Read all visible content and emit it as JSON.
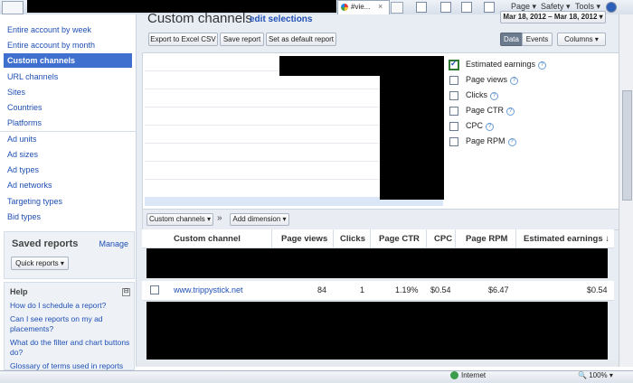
{
  "browser": {
    "tab_title": "#vie...",
    "menu": [
      "Page ▾",
      "Safety ▾",
      "Tools ▾"
    ],
    "status": "Internet",
    "zoom": "100%"
  },
  "nav": {
    "items": [
      "Entire account by week",
      "Entire account by month",
      "Custom channels",
      "URL channels",
      "Sites",
      "Countries",
      "Platforms",
      "Ad units",
      "Ad sizes",
      "Ad types",
      "Ad networks",
      "Targeting types",
      "Bid types"
    ],
    "selected_index": 2
  },
  "saved_reports": {
    "title": "Saved reports",
    "manage": "Manage",
    "quick": "Quick reports ▾"
  },
  "help": {
    "title": "Help",
    "toggle": "⊟",
    "links": [
      "How do I schedule a report?",
      "Can I see reports on my ad placements?",
      "What do the filter and chart buttons do?",
      "Glossary of terms used in reports"
    ]
  },
  "header": {
    "title": "Custom channels",
    "edit": "edit selections",
    "date_range": "Mar 18, 2012 – Mar 18, 2012 ▾",
    "buttons": [
      "Export to Excel CSV",
      "Save report",
      "Set as default report"
    ],
    "view_data": "Data",
    "view_events": "Events",
    "columns": "Columns ▾"
  },
  "legend": [
    {
      "label": "Estimated earnings",
      "checked": true
    },
    {
      "label": "Page views",
      "checked": false
    },
    {
      "label": "Clicks",
      "checked": false
    },
    {
      "label": "Page CTR",
      "checked": false
    },
    {
      "label": "CPC",
      "checked": false
    },
    {
      "label": "Page RPM",
      "checked": false
    }
  ],
  "table_controls": {
    "dim": "Custom channels ▾",
    "arrow": "»",
    "add": "Add dimension ▾"
  },
  "table": {
    "headers": [
      "Custom channel",
      "Page views",
      "Clicks",
      "Page CTR",
      "CPC",
      "Page RPM",
      "Estimated earnings ↓"
    ],
    "row": [
      "www.trippystick.net",
      "84",
      "1",
      "1.19%",
      "$0.54",
      "$6.47",
      "$0.54"
    ]
  },
  "colors": {
    "link": "#1f4fb4",
    "selected": "#3f6fcf",
    "panel": "#e8edf4"
  }
}
